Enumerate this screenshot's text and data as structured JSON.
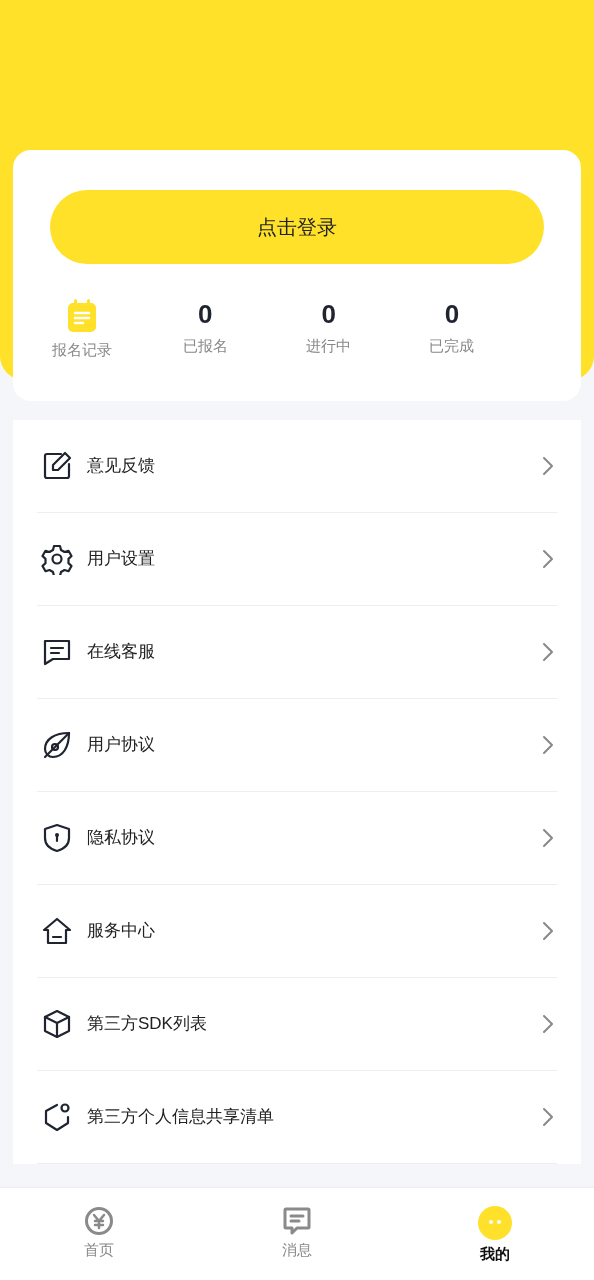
{
  "login_button": "点击登录",
  "stats": [
    {
      "kind": "icon",
      "label": "报名记录"
    },
    {
      "kind": "count",
      "value": "0",
      "label": "已报名"
    },
    {
      "kind": "count",
      "value": "0",
      "label": "进行中"
    },
    {
      "kind": "count",
      "value": "0",
      "label": "已完成"
    }
  ],
  "menu": [
    {
      "label": "意见反馈"
    },
    {
      "label": "用户设置"
    },
    {
      "label": "在线客服"
    },
    {
      "label": "用户协议"
    },
    {
      "label": "隐私协议"
    },
    {
      "label": "服务中心"
    },
    {
      "label": "第三方SDK列表"
    },
    {
      "label": "第三方个人信息共享清单"
    }
  ],
  "tab_bar": [
    {
      "label": "首页",
      "selected": false
    },
    {
      "label": "消息",
      "selected": false
    },
    {
      "label": "我的",
      "selected": true
    }
  ]
}
